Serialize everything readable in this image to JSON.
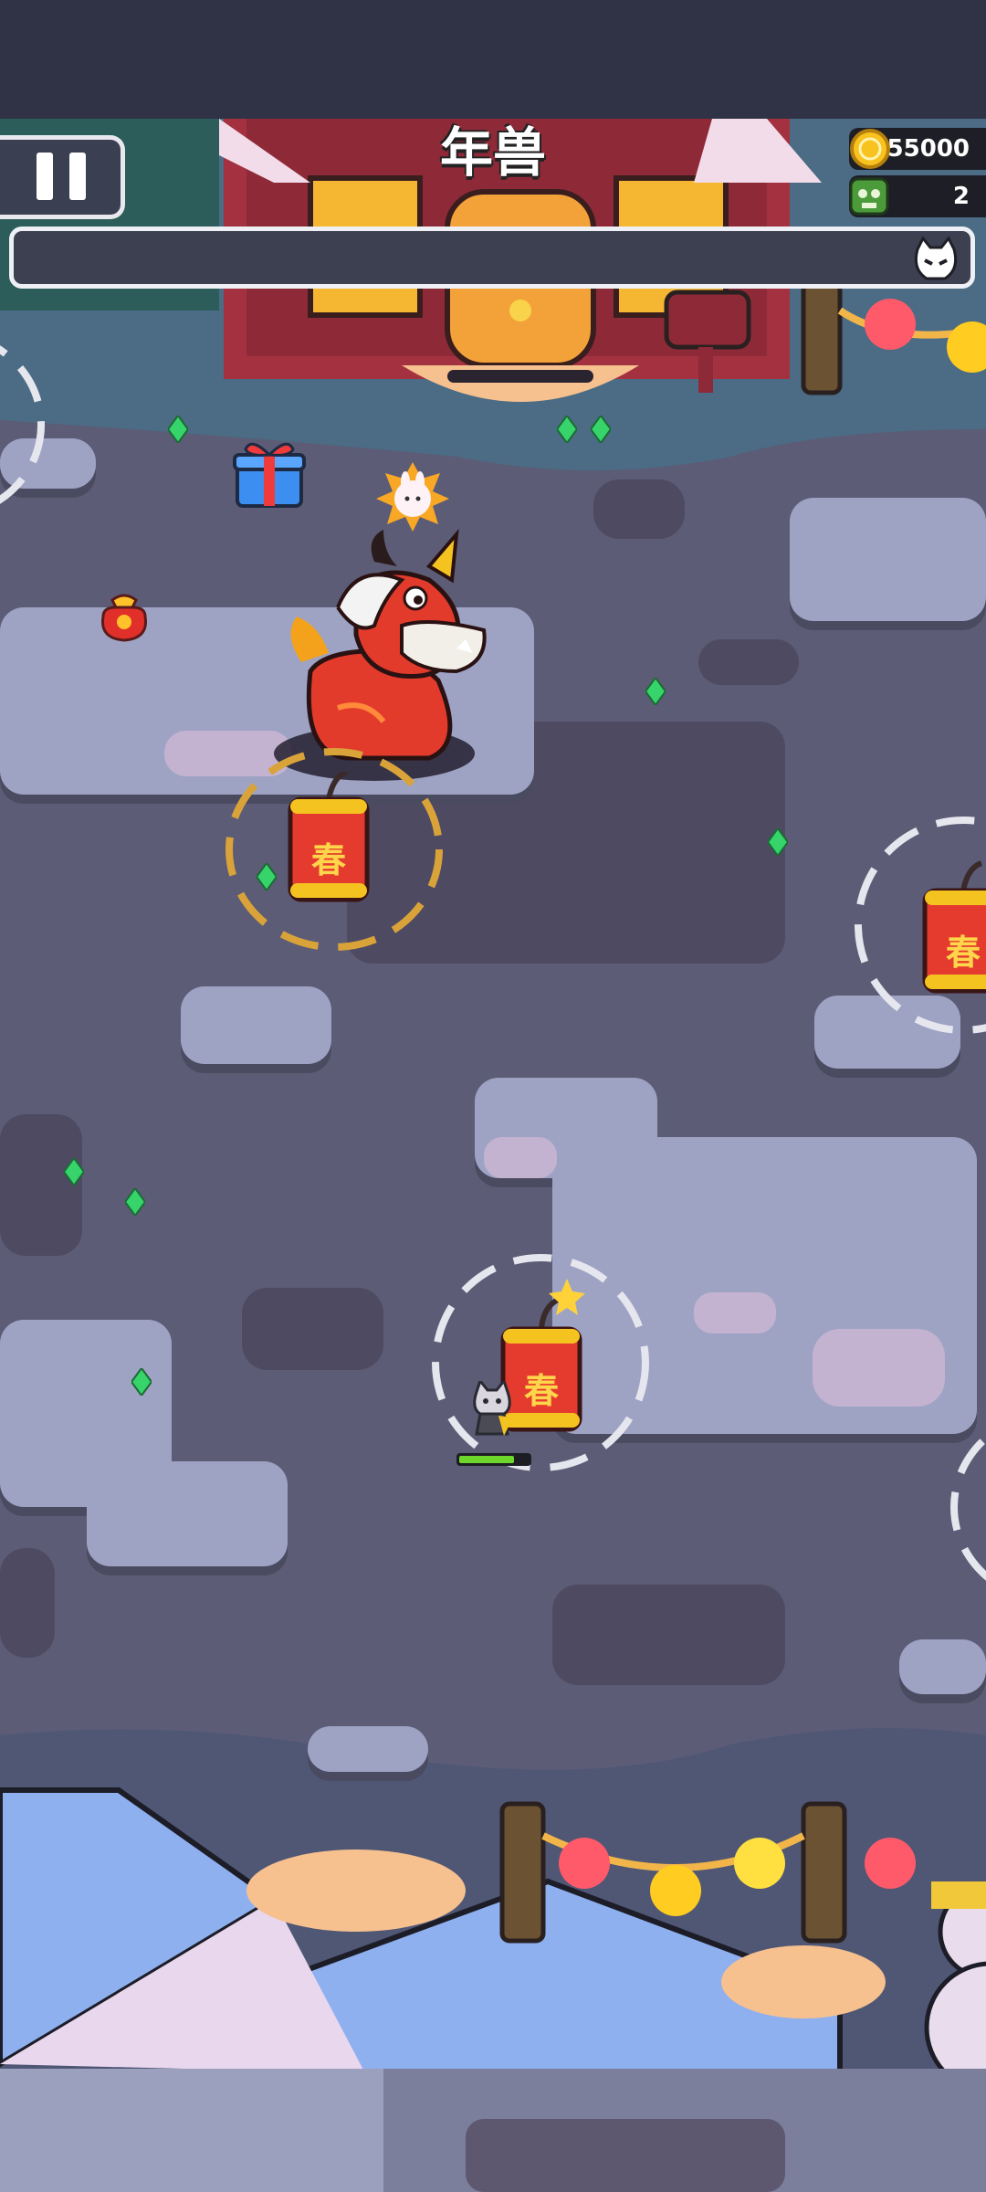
{
  "hud": {
    "boss_name": "年兽",
    "coins": "155000",
    "kills": "2",
    "boss_health_fraction": 1.0,
    "player_health_fraction": 0.8
  },
  "firecracker_label": "春",
  "icons": [
    "pause-icon",
    "coin-icon",
    "skull-icon",
    "cat-head-icon",
    "gift-icon",
    "lucky-bag-icon",
    "rabbit-badge-icon",
    "green-gem-icon"
  ],
  "colors": {
    "ground": "#5c5c76",
    "snow": "#9ea3c4",
    "accent_red": "#e53b2f",
    "accent_gold": "#f4c320",
    "gem": "#36d46b"
  }
}
